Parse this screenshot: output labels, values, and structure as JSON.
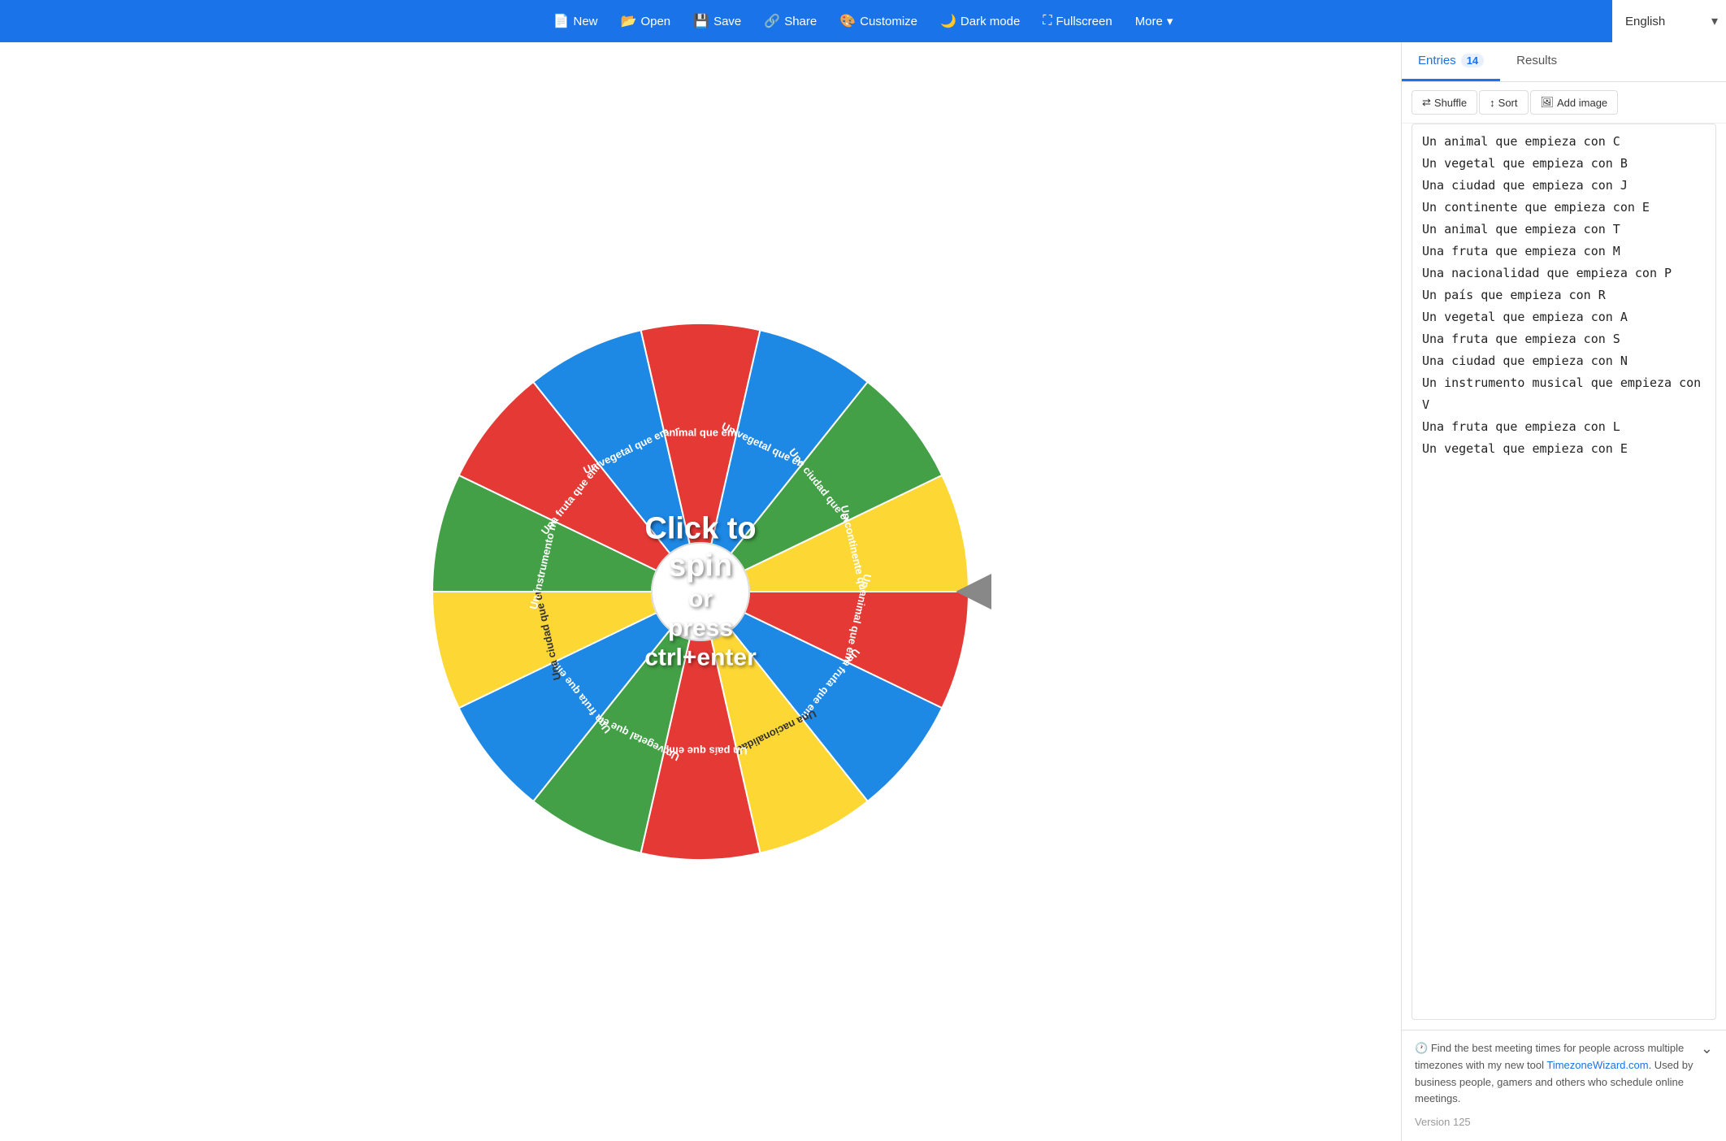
{
  "header": {
    "nav_items": [
      {
        "label": "New",
        "icon": "📄",
        "name": "new-button"
      },
      {
        "label": "Open",
        "icon": "📂",
        "name": "open-button"
      },
      {
        "label": "Save",
        "icon": "💾",
        "name": "save-button"
      },
      {
        "label": "Share",
        "icon": "🔗",
        "name": "share-button"
      },
      {
        "label": "Customize",
        "icon": "🎨",
        "name": "customize-button"
      },
      {
        "label": "Dark mode",
        "icon": "🌙",
        "name": "dark-mode-button"
      },
      {
        "label": "Fullscreen",
        "icon": "⛶",
        "name": "fullscreen-button"
      },
      {
        "label": "More",
        "icon": "▾",
        "name": "more-button"
      }
    ],
    "language": "English"
  },
  "tabs": [
    {
      "label": "Entries",
      "badge": "14",
      "active": true,
      "name": "entries-tab"
    },
    {
      "label": "Results",
      "badge": "",
      "active": false,
      "name": "results-tab"
    }
  ],
  "actions": [
    {
      "label": "Shuffle",
      "icon": "⇄",
      "name": "shuffle-button"
    },
    {
      "label": "Sort",
      "icon": "↕",
      "name": "sort-button"
    },
    {
      "label": "Add image",
      "icon": "🖼",
      "name": "add-image-button"
    }
  ],
  "entries": [
    "Un animal que empieza con C",
    "Un vegetal que empieza con B",
    "Una ciudad que empieza con J",
    "Un continente que empieza con E",
    "Un animal que empieza con T",
    "Una fruta que empieza con M",
    "Una nacionalidad que empieza con P",
    "Un país que empieza con R",
    "Un vegetal que empieza con A",
    "Una fruta que empieza con S",
    "Una ciudad que empieza con N",
    "Un instrumento musical que empieza con V",
    "Una fruta que empieza con L",
    "Un vegetal que empieza con E"
  ],
  "wheel": {
    "click_text": "Click to spin",
    "or_text": "or",
    "press_text": "press ctrl+enter",
    "segments": [
      {
        "label": "Un animal que emp...",
        "color": "#e53935",
        "textColor": "#fff"
      },
      {
        "label": "Un vegetal que em...",
        "color": "#1e88e5",
        "textColor": "#fff"
      },
      {
        "label": "Una ciudad que em...",
        "color": "#43a047",
        "textColor": "#fff"
      },
      {
        "label": "Un continente que em...",
        "color": "#fdd835",
        "textColor": "#fff"
      },
      {
        "label": "Un animal que emp...",
        "color": "#e53935",
        "textColor": "#fff"
      },
      {
        "label": "Una fruta que emp...",
        "color": "#1e88e5",
        "textColor": "#fff"
      },
      {
        "label": "Una nacionalidad ...",
        "color": "#fdd835",
        "textColor": "#333"
      },
      {
        "label": "Un país que emp...",
        "color": "#e53935",
        "textColor": "#fff"
      },
      {
        "label": "Un vegetal que em...",
        "color": "#43a047",
        "textColor": "#fff"
      },
      {
        "label": "Una fruta que emp...",
        "color": "#1e88e5",
        "textColor": "#fff"
      },
      {
        "label": "Una ciudad que em...",
        "color": "#fdd835",
        "textColor": "#333"
      },
      {
        "label": "Un instrumento mu...",
        "color": "#43a047",
        "textColor": "#fff"
      },
      {
        "label": "Una fruta que emp...",
        "color": "#e53935",
        "textColor": "#fff"
      },
      {
        "label": "Un vegetal que em...",
        "color": "#1e88e5",
        "textColor": "#fff"
      }
    ]
  },
  "info": {
    "clock_icon": "🕐",
    "text": "Find the best meeting times for people across multiple timezones with my new tool",
    "link_text": "TimezoneWizard.com",
    "link_url": "#",
    "suffix": ". Used by business people, gamers and others who schedule online meetings.",
    "version": "Version 125"
  }
}
